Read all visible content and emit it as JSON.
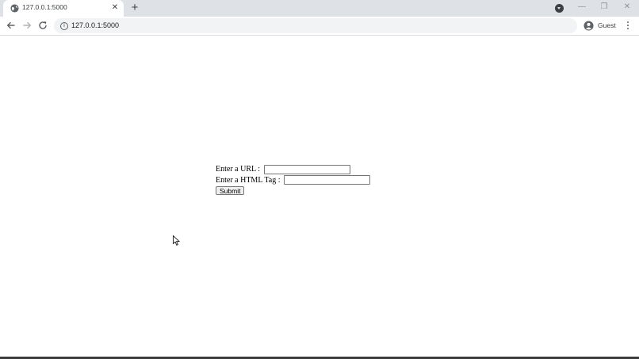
{
  "browser": {
    "tab": {
      "title": "127.0.0.1:5000",
      "close_glyph": "✕"
    },
    "new_tab_glyph": "+",
    "window_controls": {
      "minimize": "—",
      "restore": "❐",
      "close": "✕"
    },
    "address_bar": {
      "url": "127.0.0.1:5000"
    },
    "profile": {
      "label": "Guest"
    }
  },
  "form": {
    "url_label": "Enter a URL :",
    "url_value": "",
    "tag_label": "Enter a HTML Tag :",
    "tag_value": "",
    "submit_label": "Submit"
  },
  "colors": {
    "tabstrip_bg": "#dee1e6",
    "omnibox_bg": "#f1f3f4",
    "icon": "#5f6368",
    "page_bg": "#ffffff"
  }
}
